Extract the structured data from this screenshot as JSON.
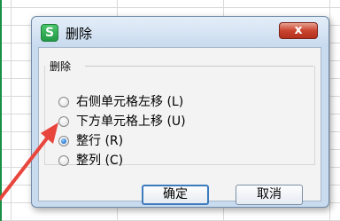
{
  "dialog": {
    "title": "删除",
    "app_icon_letter": "S",
    "close_symbol": "x",
    "group_label": "删除",
    "options": [
      {
        "label": "右侧单元格左移 (L)",
        "checked": false
      },
      {
        "label": "下方单元格上移 (U)",
        "checked": false
      },
      {
        "label": "整行 (R)",
        "checked": true
      },
      {
        "label": "整列 (C)",
        "checked": false
      }
    ],
    "ok_label": "确定",
    "cancel_label": "取消"
  },
  "colors": {
    "arrow": "#e8453c",
    "app_icon": "#2fae55",
    "close_button": "#c9442f"
  }
}
